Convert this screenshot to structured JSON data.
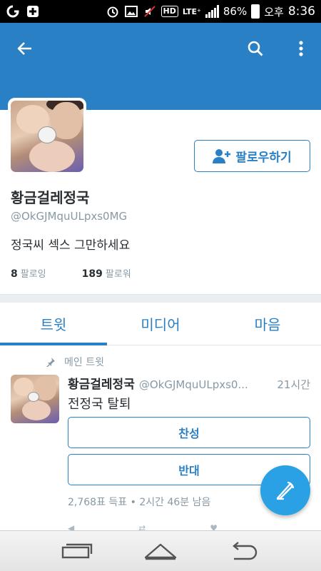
{
  "status_bar": {
    "battery": "86%",
    "ampm": "오후",
    "time": "8:36",
    "hd_label": "HD",
    "network": "LTE⁺"
  },
  "header": {
    "back_icon": "arrow-left-icon",
    "search_icon": "search-icon",
    "more_icon": "more-vertical-icon",
    "color": "#2a80c5"
  },
  "profile": {
    "name": "황금걸레정국",
    "handle": "@OkGJMquULpxs0MG",
    "bio": "정국씨 섹스 그만하세요",
    "following_count": "8",
    "following_label": "팔로잉",
    "followers_count": "189",
    "followers_label": "팔로워",
    "follow_button": "팔로우하기"
  },
  "tabs": [
    {
      "label": "트윗",
      "active": true
    },
    {
      "label": "미디어",
      "active": false
    },
    {
      "label": "마음",
      "active": false
    }
  ],
  "tweet": {
    "pinned_label": "메인 트윗",
    "name": "황금걸레정국",
    "handle": "@OkGJMquULpxs0...",
    "time": "21시간",
    "text": "전정국 탈퇴",
    "poll": {
      "options": [
        "찬성",
        "반대"
      ],
      "meta": "2,768표 득표 • 2시간 46분  남음"
    }
  },
  "colors": {
    "accent": "#2a80c5",
    "fab": "#2aa1e5",
    "muted": "#8899a6"
  }
}
